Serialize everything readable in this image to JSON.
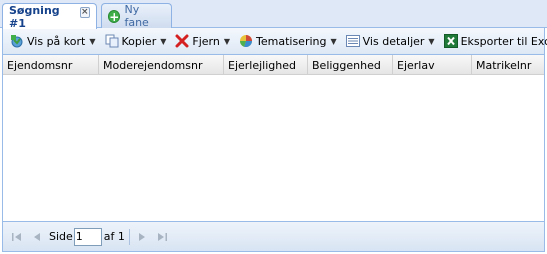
{
  "tabs": [
    {
      "label": "Søgning #1",
      "active": true
    },
    {
      "label": "Ny fane",
      "active": false
    }
  ],
  "toolbar": {
    "show_on_map": "Vis på kort",
    "copy": "Kopier",
    "remove": "Fjern",
    "theming": "Tematisering",
    "show_details": "Vis detaljer",
    "export_excel": "Eksporter til Excel"
  },
  "grid": {
    "columns": [
      "Ejendomsnr",
      "Moderejendomsnr",
      "Ejerlejlighed",
      "Beliggenhed",
      "Ejerlav",
      "Matrikelnr"
    ]
  },
  "pager": {
    "page_label": "Side",
    "page_value": "1",
    "of_label": "af 1"
  },
  "colors": {
    "accent": "#15428b",
    "border": "#99bbe8"
  }
}
